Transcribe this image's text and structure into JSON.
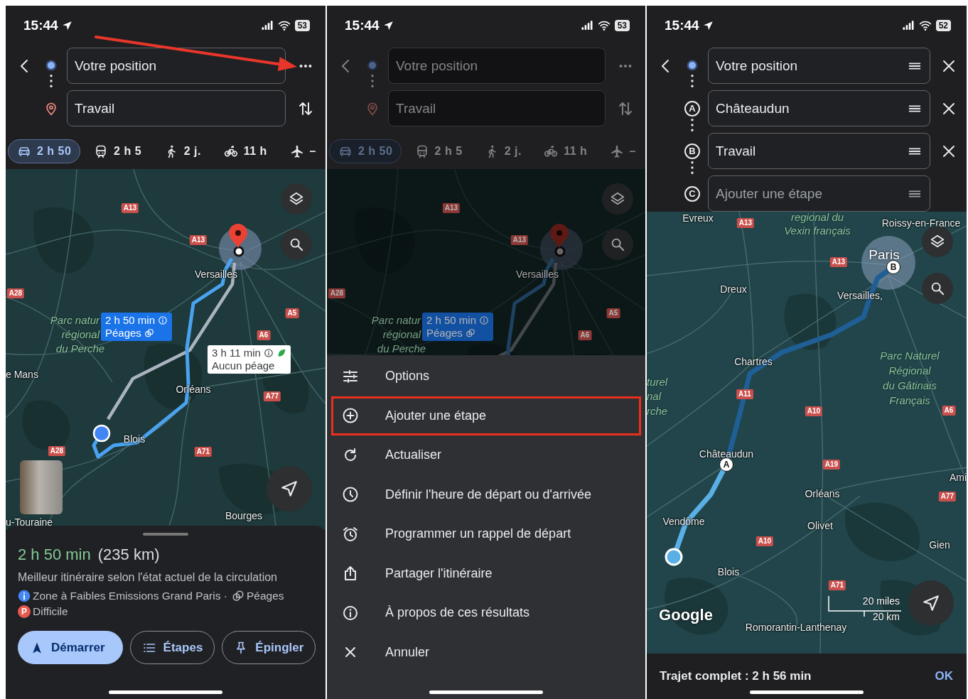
{
  "screens": [
    {
      "kind": "directions",
      "dimmed": false,
      "status": {
        "time": "15:44",
        "battery": "53"
      },
      "header": {
        "kind": "route",
        "fields": [
          {
            "kind": "origin",
            "value": "Votre position"
          },
          {
            "kind": "destination",
            "value": "Travail"
          }
        ]
      },
      "modes": [
        {
          "kind": "car",
          "label": "2 h 50",
          "selected": true
        },
        {
          "kind": "transit",
          "label": "2 h 5",
          "selected": false
        },
        {
          "kind": "walk",
          "label": "2 j.",
          "selected": false
        },
        {
          "kind": "bike",
          "label": "11 h",
          "selected": false
        },
        {
          "kind": "flight",
          "label": "–",
          "selected": false
        }
      ],
      "map": {
        "kind": "overview",
        "labels": [
          {
            "kind": "shield",
            "text": "A13"
          },
          {
            "kind": "shield",
            "text": "A13"
          },
          {
            "kind": "city",
            "text": "Versailles"
          },
          {
            "kind": "shield",
            "text": "A28"
          },
          {
            "kind": "park",
            "text": "Parc natur"
          },
          {
            "kind": "park",
            "text": "régional"
          },
          {
            "kind": "park",
            "text": "du Perche"
          },
          {
            "kind": "shield",
            "text": "A5"
          },
          {
            "kind": "shield",
            "text": "A6"
          },
          {
            "kind": "city",
            "text": "e Mans"
          },
          {
            "kind": "city",
            "text": "Orléans"
          },
          {
            "kind": "shield",
            "text": "A77"
          },
          {
            "kind": "city",
            "text": "Blois"
          },
          {
            "kind": "shield",
            "text": "A28"
          },
          {
            "kind": "shield",
            "text": "A71"
          },
          {
            "kind": "city",
            "text": "u-Touraine"
          },
          {
            "kind": "city",
            "text": "Bourges"
          }
        ],
        "callouts": [
          {
            "kind": "toll",
            "selected": true,
            "duration": "2 h 50 min",
            "note": "Péages"
          },
          {
            "kind": "eco",
            "selected": false,
            "duration": "3 h 11 min",
            "note": "Aucun péage"
          }
        ]
      },
      "summary": {
        "duration": "2 h 50 min",
        "distance": "(235 km)",
        "description": "Meilleur itinéraire selon l'état actuel de la circulation",
        "notes": [
          {
            "kind": "info",
            "text": "Zone à Faibles Emissions Grand Paris ·"
          },
          {
            "kind": "toll",
            "text": "Péages"
          },
          {
            "kind": "parking",
            "badge": "P",
            "text": "Difficile"
          }
        ],
        "buttons": [
          {
            "kind": "start",
            "label": "Démarrer"
          },
          {
            "kind": "steps",
            "label": "Étapes"
          },
          {
            "kind": "pin",
            "label": "Épingler"
          }
        ]
      },
      "annotation": {
        "kind": "arrow"
      }
    },
    {
      "kind": "menu",
      "dimmed": true,
      "status": {
        "time": "15:44",
        "battery": "53"
      },
      "header": {
        "kind": "route",
        "fields": [
          {
            "kind": "origin",
            "value": "Votre position"
          },
          {
            "kind": "destination",
            "value": "Travail"
          }
        ]
      },
      "modes": [
        {
          "kind": "car",
          "label": "2 h 50",
          "selected": true
        },
        {
          "kind": "transit",
          "label": "2 h 5",
          "selected": false
        },
        {
          "kind": "walk",
          "label": "2 j.",
          "selected": false
        },
        {
          "kind": "bike",
          "label": "11 h",
          "selected": false
        },
        {
          "kind": "flight",
          "label": "–",
          "selected": false
        }
      ],
      "map": {
        "kind": "overview",
        "labels": [
          {
            "kind": "shield",
            "text": "A13"
          },
          {
            "kind": "shield",
            "text": "A13"
          },
          {
            "kind": "city",
            "text": "Versailles"
          },
          {
            "kind": "shield",
            "text": "A28"
          },
          {
            "kind": "park",
            "text": "Parc natur"
          },
          {
            "kind": "park",
            "text": "régional"
          },
          {
            "kind": "park",
            "text": "du Perche"
          },
          {
            "kind": "shield",
            "text": "A5"
          },
          {
            "kind": "shield",
            "text": "A6"
          }
        ],
        "callouts": [
          {
            "kind": "toll",
            "selected": true,
            "duration": "2 h 50 min",
            "note": "Péages"
          }
        ]
      },
      "menu": [
        {
          "kind": "options",
          "label": "Options",
          "highlighted": false
        },
        {
          "kind": "add",
          "label": "Ajouter une étape",
          "highlighted": true
        },
        {
          "kind": "refresh",
          "label": "Actualiser",
          "highlighted": false
        },
        {
          "kind": "clock",
          "label": "Définir l'heure de départ ou d'arrivée",
          "highlighted": false
        },
        {
          "kind": "alarm",
          "label": "Programmer un rappel de départ",
          "highlighted": false
        },
        {
          "kind": "share",
          "label": "Partager l'itinéraire",
          "highlighted": false
        },
        {
          "kind": "info",
          "label": "À propos de ces résultats",
          "highlighted": false
        },
        {
          "kind": "cancel",
          "label": "Annuler",
          "highlighted": false
        }
      ]
    },
    {
      "kind": "editor",
      "dimmed": false,
      "status": {
        "time": "15:44",
        "battery": "52"
      },
      "header": {
        "kind": "editor",
        "fields": [
          {
            "kind": "origin",
            "value": "Votre position",
            "removable": true
          },
          {
            "kind": "letter",
            "letter": "A",
            "value": "Châteaudun",
            "removable": true
          },
          {
            "kind": "letter",
            "letter": "B",
            "value": "Travail",
            "removable": true
          },
          {
            "kind": "letter",
            "letter": "C",
            "placeholder": "Ajouter une étape",
            "removable": false
          }
        ]
      },
      "trip": {
        "total": "Trajet complet : 2 h 56 min",
        "confirm": "OK"
      },
      "map": {
        "kind": "waypoints",
        "labels": [
          {
            "kind": "city",
            "text": "Evreux"
          },
          {
            "kind": "shield",
            "text": "A13"
          },
          {
            "kind": "park",
            "text": "regional du"
          },
          {
            "kind": "park",
            "text": "Vexin français"
          },
          {
            "kind": "city",
            "text": "Roissy-en-France"
          },
          {
            "kind": "shield",
            "text": "A13"
          },
          {
            "kind": "capital",
            "text": "Paris"
          },
          {
            "kind": "city",
            "text": "Dreux"
          },
          {
            "kind": "city",
            "text": "Versailles,"
          },
          {
            "kind": "city",
            "text": "Chartres"
          },
          {
            "kind": "park",
            "text": "turel"
          },
          {
            "kind": "park",
            "text": "nal"
          },
          {
            "kind": "park",
            "text": "rche"
          },
          {
            "kind": "park",
            "text": "Parc Naturel"
          },
          {
            "kind": "park",
            "text": "Régional"
          },
          {
            "kind": "park",
            "text": "du Gâtinais"
          },
          {
            "kind": "park",
            "text": "Français"
          },
          {
            "kind": "shield",
            "text": "A11"
          },
          {
            "kind": "shield",
            "text": "A10"
          },
          {
            "kind": "shield",
            "text": "A6"
          },
          {
            "kind": "city",
            "text": "Châteaudun"
          },
          {
            "kind": "shield",
            "text": "A19"
          },
          {
            "kind": "city",
            "text": "Ami"
          },
          {
            "kind": "city",
            "text": "Orléans"
          },
          {
            "kind": "shield",
            "text": "A77"
          },
          {
            "kind": "city",
            "text": "Vendôme"
          },
          {
            "kind": "city",
            "text": "Olivet"
          },
          {
            "kind": "shield",
            "text": "A10"
          },
          {
            "kind": "city",
            "text": "Gien"
          },
          {
            "kind": "city",
            "text": "Blois"
          },
          {
            "kind": "shield",
            "text": "A71"
          },
          {
            "kind": "city",
            "text": "Romorantin-Lanthenay"
          }
        ],
        "waypoints": [
          "A",
          "B"
        ],
        "attribution": "Google",
        "scale": {
          "imperial": "20 miles",
          "metric": "20 km"
        }
      }
    }
  ]
}
